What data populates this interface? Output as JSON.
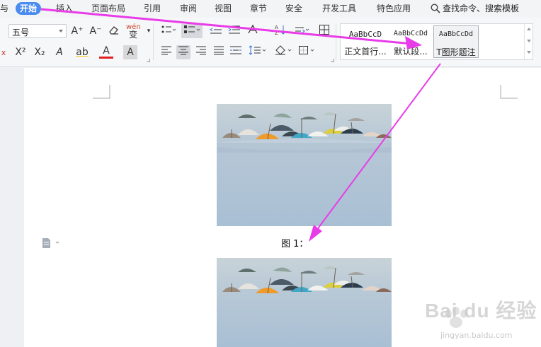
{
  "menu": {
    "partial": "与",
    "tabs": [
      "开始",
      "插入",
      "页面布局",
      "引用",
      "审阅",
      "视图",
      "章节",
      "安全",
      "开发工具",
      "特色应用"
    ],
    "search": "查找命令、搜索模板"
  },
  "ribbon": {
    "font_size": "五号",
    "buttons": {
      "grow": "A⁺",
      "shrink": "A⁻",
      "pinyin": "wén",
      "superscript": "X²",
      "subscript": "X₂",
      "effect": "A",
      "highlight": "ab",
      "color": "A",
      "shade": "A"
    }
  },
  "styles": [
    {
      "preview": "AaBbCcD",
      "name": "正文首行..."
    },
    {
      "preview": "AaBbCcDd",
      "name": "默认段..."
    },
    {
      "preview": "AaBbCcDd",
      "name": "T图形题注"
    }
  ],
  "document": {
    "caption": "图 1："
  },
  "watermark": {
    "text": "Bai du 经验",
    "url": "jingyan.baidu.com"
  },
  "colors": {
    "accent": "#4a8bf0",
    "arrow": "#e83ce8",
    "sky": "#adc2d6"
  }
}
